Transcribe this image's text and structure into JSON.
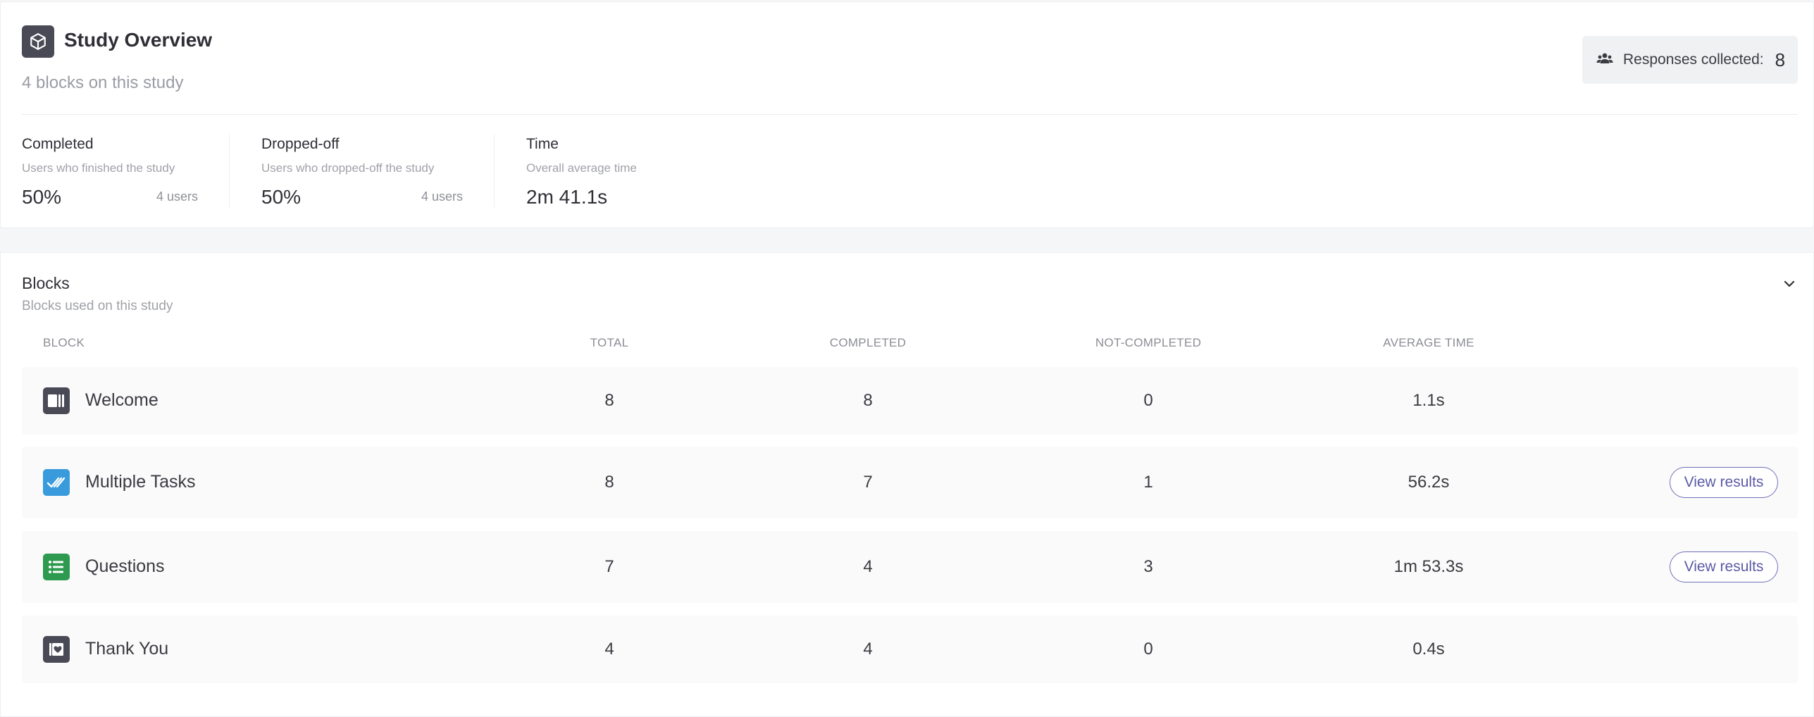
{
  "overview": {
    "icon": "cube-icon",
    "title": "Study Overview",
    "subtitle": "4 blocks on this study",
    "responses": {
      "icon": "users-icon",
      "label": "Responses collected:",
      "count": "8"
    },
    "stats": [
      {
        "title": "Completed",
        "description": "Users who finished the study",
        "value": "50%",
        "users": "4 users"
      },
      {
        "title": "Dropped-off",
        "description": "Users who dropped-off the study",
        "value": "50%",
        "users": "4 users"
      },
      {
        "title": "Time",
        "description": "Overall average time",
        "value": "2m 41.1s"
      }
    ]
  },
  "blocks": {
    "title": "Blocks",
    "subtitle": "Blocks used on this study",
    "collapse_icon": "chevron-down-icon",
    "columns": [
      "BLOCK",
      "TOTAL",
      "COMPLETED",
      "NOT-COMPLETED",
      "AVERAGE TIME"
    ],
    "rows": [
      {
        "name": "Welcome",
        "icon": "welcome-block-icon",
        "icon_color": "#4a4a57",
        "total": "8",
        "completed": "8",
        "not_completed": "0",
        "avg_time": "1.1s",
        "action": ""
      },
      {
        "name": "Multiple Tasks",
        "icon": "double-check-icon",
        "icon_color": "#3a9bdc",
        "total": "8",
        "completed": "7",
        "not_completed": "1",
        "avg_time": "56.2s",
        "action": "View results"
      },
      {
        "name": "Questions",
        "icon": "list-icon",
        "icon_color": "#2d9a4f",
        "total": "7",
        "completed": "4",
        "not_completed": "3",
        "avg_time": "1m 53.3s",
        "action": "View results"
      },
      {
        "name": "Thank You",
        "icon": "heart-flag-icon",
        "icon_color": "#4a4a57",
        "total": "4",
        "completed": "4",
        "not_completed": "0",
        "avg_time": "0.4s",
        "action": ""
      }
    ]
  }
}
